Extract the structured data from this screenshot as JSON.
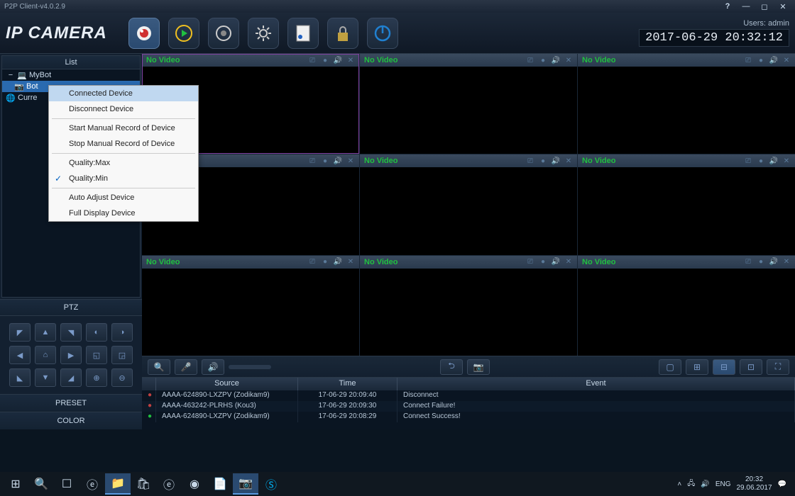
{
  "titlebar": {
    "title": "P2P Client-v4.0.2.9"
  },
  "header": {
    "logo": "IP CAMERA",
    "users_label": "Users:  admin",
    "timestamp": "2017-06-29 20:32:12"
  },
  "sidebar": {
    "tree_header": "List",
    "items": [
      {
        "label": "MyBot"
      },
      {
        "label": "Bot"
      },
      {
        "label": "Curre"
      }
    ],
    "ptz_header": "PTZ",
    "preset_label": "PRESET",
    "color_label": "COLOR"
  },
  "video": {
    "no_video": "No Video"
  },
  "log": {
    "headers": {
      "source": "Source",
      "time": "Time",
      "event": "Event"
    },
    "rows": [
      {
        "icon": "●",
        "color": "#c04040",
        "source": "AAAA-624890-LXZPV (Zodikam9)",
        "time": "17-06-29 20:09:40",
        "event": "Disconnect"
      },
      {
        "icon": "●",
        "color": "#c04040",
        "source": "AAAA-463242-PLRHS (Kou3)",
        "time": "17-06-29 20:09:30",
        "event": "Connect Failure!"
      },
      {
        "icon": "●",
        "color": "#20c040",
        "source": "AAAA-624890-LXZPV (Zodikam9)",
        "time": "17-06-29 20:08:29",
        "event": "Connect Success!"
      }
    ]
  },
  "context_menu": {
    "items": [
      {
        "label": "Connected Device",
        "highlight": true
      },
      {
        "label": "Disconnect Device"
      },
      {
        "sep": true
      },
      {
        "label": "Start Manual Record of Device"
      },
      {
        "label": "Stop Manual Record of Device"
      },
      {
        "sep": true
      },
      {
        "label": "Quality:Max"
      },
      {
        "label": "Quality:Min",
        "checked": true
      },
      {
        "sep": true
      },
      {
        "label": "Auto Adjust Device"
      },
      {
        "label": "Full Display Device"
      }
    ]
  },
  "taskbar": {
    "lang": "ENG",
    "time": "20:32",
    "date": "29.06.2017"
  }
}
